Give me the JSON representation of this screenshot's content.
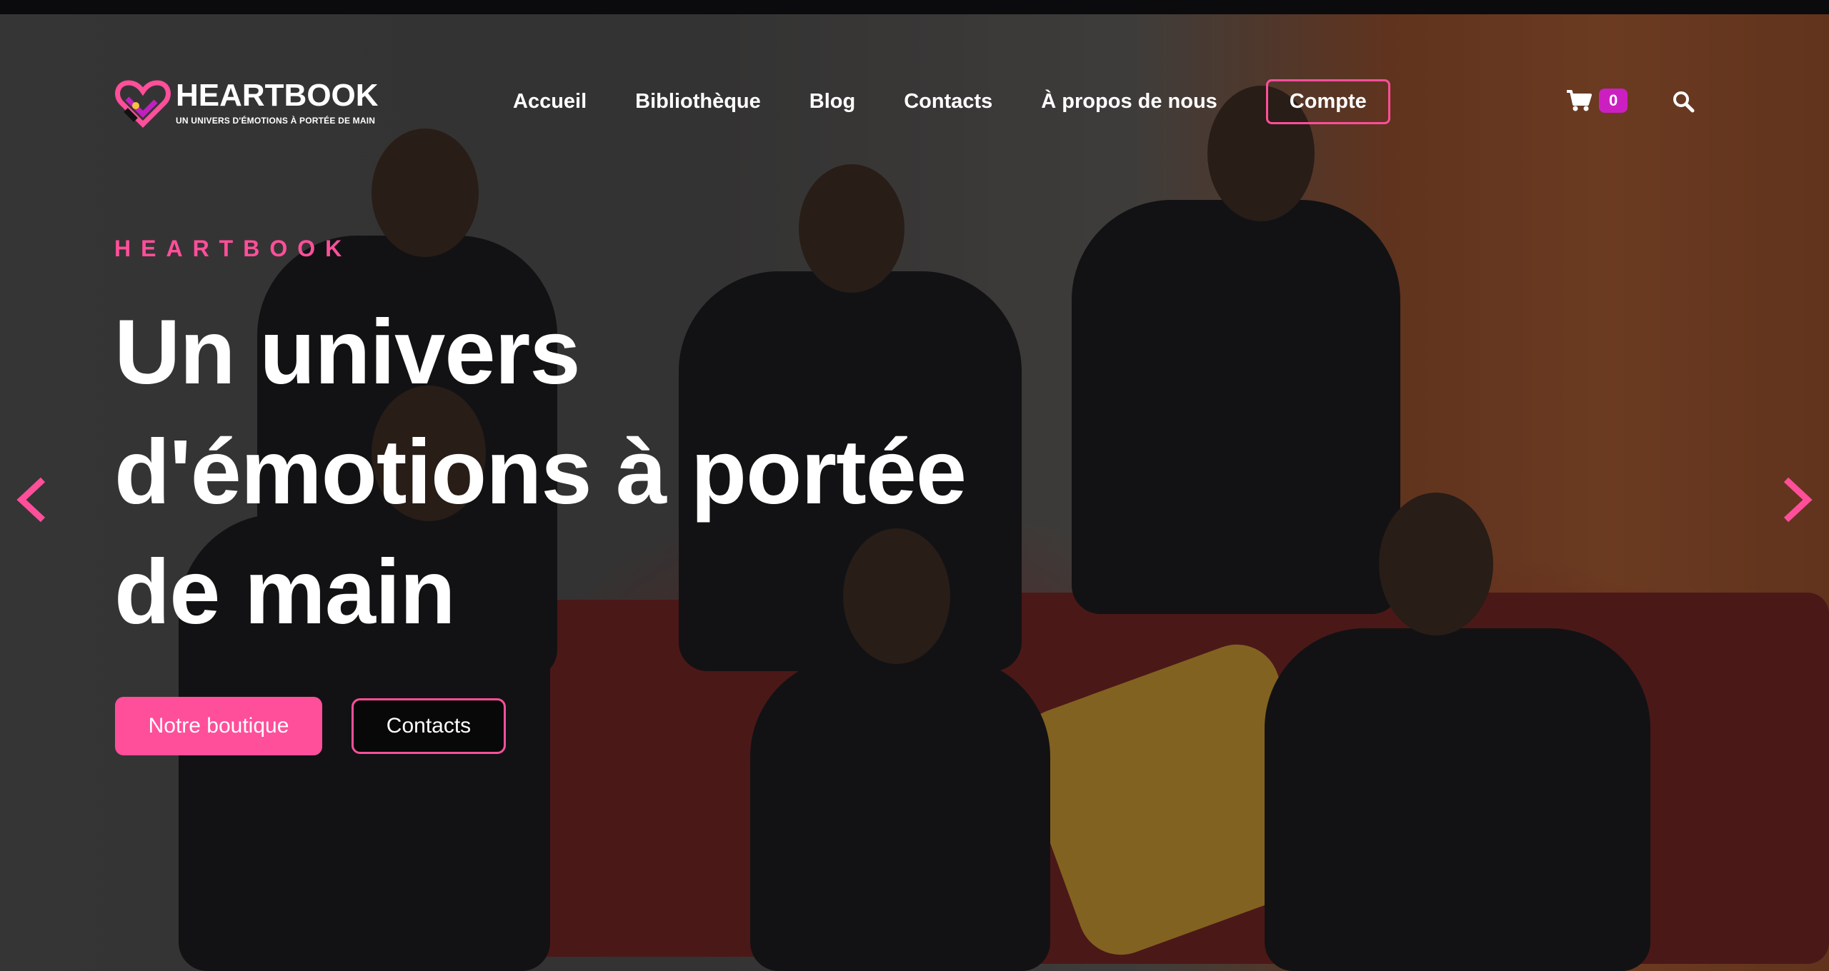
{
  "brand": {
    "name": "HEARTBOOK",
    "tagline": "UN UNIVERS D'ÉMOTIONS À PORTÉE DE MAIN",
    "accent": "#ff4f9a",
    "badge_color": "#cc1fc2"
  },
  "nav": {
    "items": [
      {
        "label": "Accueil"
      },
      {
        "label": "Bibliothèque"
      },
      {
        "label": "Blog"
      },
      {
        "label": "Contacts"
      },
      {
        "label": "À propos de nous"
      }
    ],
    "account_label": "Compte",
    "cart_icon": "cart-icon",
    "cart_count": "0",
    "search_icon": "search-icon"
  },
  "hero": {
    "eyebrow": "HEARTBOOK",
    "headline": "Un univers d'émotions à portée de main",
    "primary_button": "Notre boutique",
    "secondary_button": "Contacts",
    "prev_icon": "chevron-left-icon",
    "next_icon": "chevron-right-icon"
  }
}
